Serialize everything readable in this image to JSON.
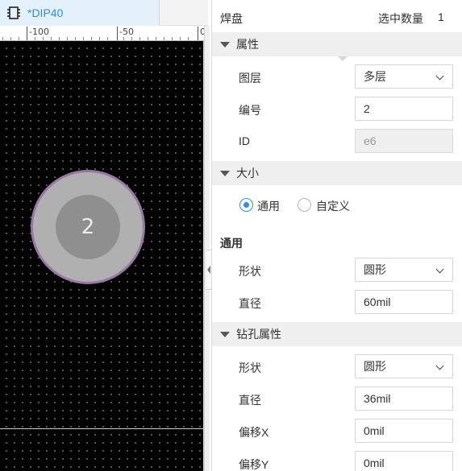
{
  "tab": {
    "title": "*DIP40",
    "icon": "chip-icon"
  },
  "ruler": {
    "labels": [
      "-100",
      "-50",
      "0"
    ]
  },
  "canvas": {
    "pad_number": "2",
    "pad_fill": "#b0b0b0",
    "pad_outline": "#9a76a2",
    "hole_fill": "#8f8f8f"
  },
  "panel": {
    "title": "焊盘",
    "selected_count_label": "选中数量",
    "selected_count": "1",
    "sections": {
      "properties": "属性",
      "size": "大小",
      "drill": "钻孔属性"
    },
    "properties": {
      "layer_label": "图层",
      "layer_value": "多层",
      "number_label": "编号",
      "number_value": "2",
      "id_label": "ID",
      "id_value": "e6"
    },
    "size": {
      "radio_general": "通用",
      "radio_custom": "自定义",
      "selected": "通用",
      "subheading": "通用",
      "shape_label": "形状",
      "shape_value": "圆形",
      "diameter_label": "直径",
      "diameter_value": "60mil"
    },
    "drill": {
      "shape_label": "形状",
      "shape_value": "圆形",
      "diameter_label": "直径",
      "diameter_value": "36mil",
      "offset_x_label": "偏移X",
      "offset_x_value": "0mil",
      "offset_y_label": "偏移Y",
      "offset_y_value": "0mil"
    }
  },
  "colors": {
    "accent": "#2f8ee0",
    "section_bg": "#efefef",
    "canvas_bg": "#000000"
  }
}
